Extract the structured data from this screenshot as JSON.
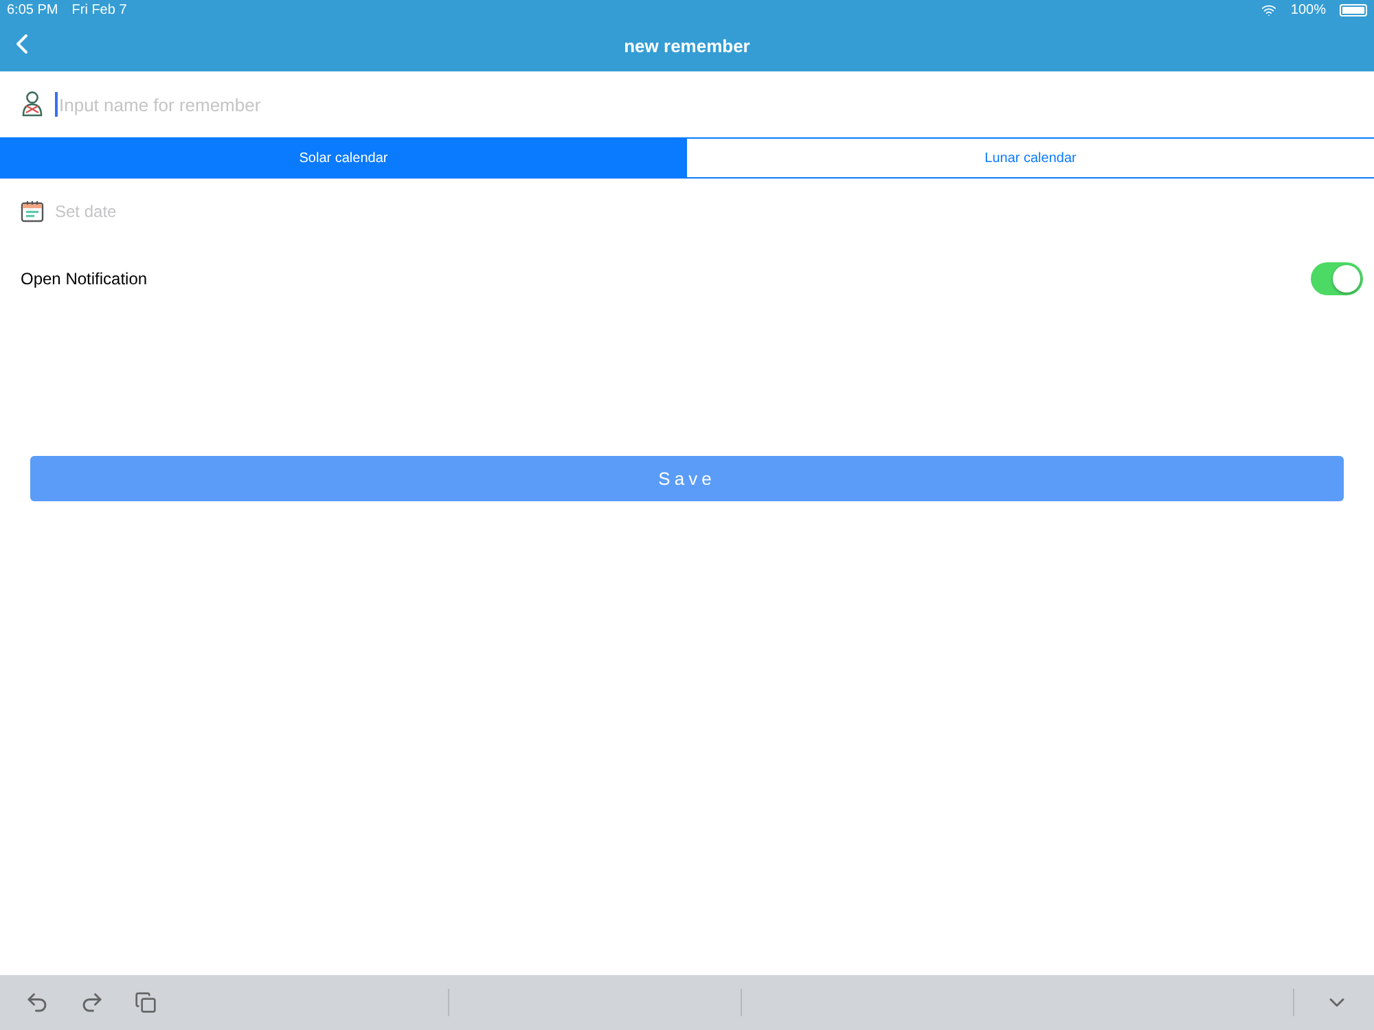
{
  "status_bar": {
    "time": "6:05 PM",
    "date": "Fri Feb 7",
    "battery": "100%"
  },
  "nav": {
    "title": "new remember"
  },
  "name_field": {
    "placeholder": "Input name for remember"
  },
  "tabs": [
    {
      "label": "Solar calendar",
      "selected": true
    },
    {
      "label": "Lunar calendar",
      "selected": false
    }
  ],
  "date_field": {
    "placeholder": "Set date"
  },
  "notification": {
    "label": "Open Notification",
    "on": true
  },
  "save_button": "Save"
}
